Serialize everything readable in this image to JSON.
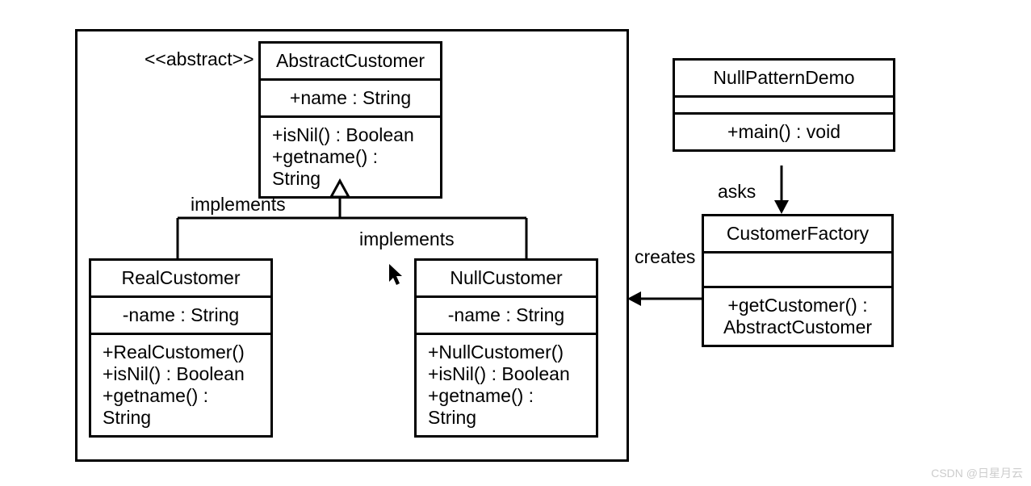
{
  "stereotype": "<<abstract>>",
  "labels": {
    "implements1": "implements",
    "implements2": "implements",
    "asks": "asks",
    "creates": "creates"
  },
  "classes": {
    "abstractCustomer": {
      "name": "AbstractCustomer",
      "attrs": [
        "+name : String"
      ],
      "ops": [
        "+isNil() : Boolean",
        "+getname() : String"
      ]
    },
    "realCustomer": {
      "name": "RealCustomer",
      "attrs": [
        "-name : String"
      ],
      "ops": [
        "+RealCustomer()",
        "+isNil() : Boolean",
        "+getname() : String"
      ]
    },
    "nullCustomer": {
      "name": "NullCustomer",
      "attrs": [
        "-name : String"
      ],
      "ops": [
        "+NullCustomer()",
        "+isNil() : Boolean",
        "+getname() : String"
      ]
    },
    "nullPatternDemo": {
      "name": "NullPatternDemo",
      "ops": [
        "+main() : void"
      ]
    },
    "customerFactory": {
      "name": "CustomerFactory",
      "ops": [
        "+getCustomer() : AbstractCustomer"
      ]
    }
  },
  "watermark": "CSDN @日星月云"
}
